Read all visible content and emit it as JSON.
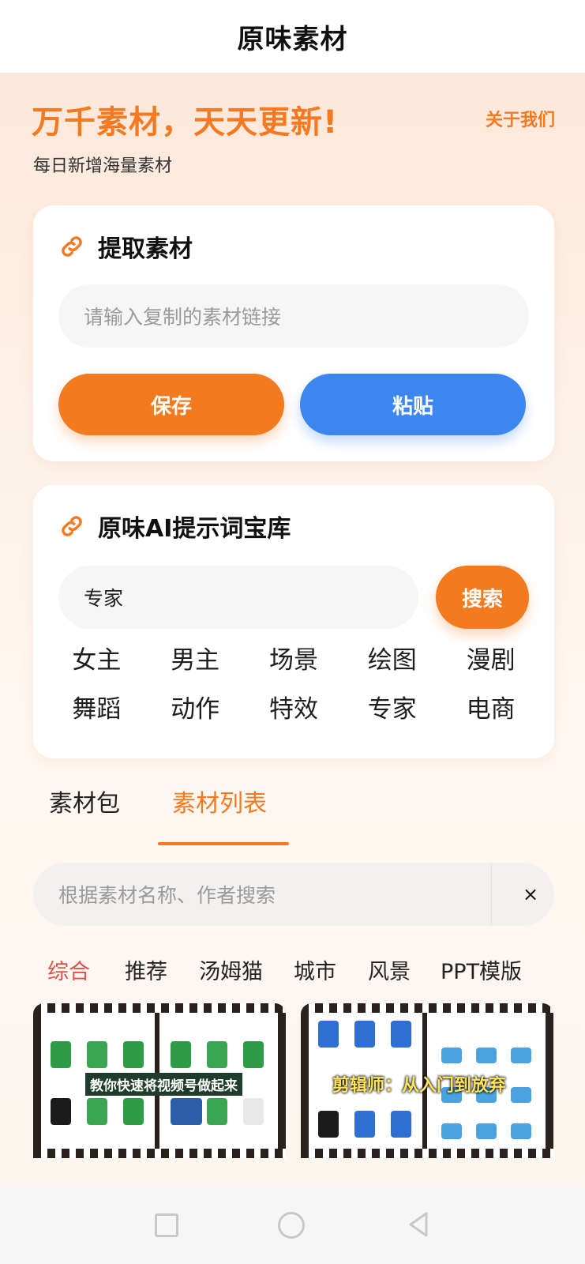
{
  "app": {
    "title": "原味素材"
  },
  "hero": {
    "title": "万千素材，天天更新!",
    "subtitle": "每日新增海量素材",
    "about_link": "关于我们"
  },
  "extract_card": {
    "icon": "link-icon",
    "title": "提取素材",
    "input_placeholder": "请输入复制的素材链接",
    "save_label": "保存",
    "paste_label": "粘贴"
  },
  "prompt_card": {
    "icon": "link-icon",
    "title": "原味AI提示词宝库",
    "search_value": "专家",
    "search_label": "搜索",
    "tags": [
      "女主",
      "男主",
      "场景",
      "绘图",
      "漫剧",
      "舞蹈",
      "动作",
      "特效",
      "专家",
      "电商"
    ]
  },
  "tabs": {
    "items": [
      "素材包",
      "素材列表"
    ],
    "active": "素材列表"
  },
  "material_search": {
    "placeholder": "根据素材名称、作者搜索",
    "clear_icon": "×"
  },
  "categories": {
    "items": [
      "综合",
      "推荐",
      "汤姆猫",
      "城市",
      "风景",
      "PPT模版"
    ],
    "active": "综合"
  },
  "thumbnails": [
    {
      "caption": "教你快速将视频号做起来"
    },
    {
      "caption": "剪辑师：从入门到放弃"
    }
  ],
  "colors": {
    "accent_orange": "#f47920",
    "button_blue": "#3d86f0",
    "active_category": "#e2504a"
  },
  "system_nav": [
    "square-icon",
    "circle-icon",
    "back-triangle-icon"
  ]
}
